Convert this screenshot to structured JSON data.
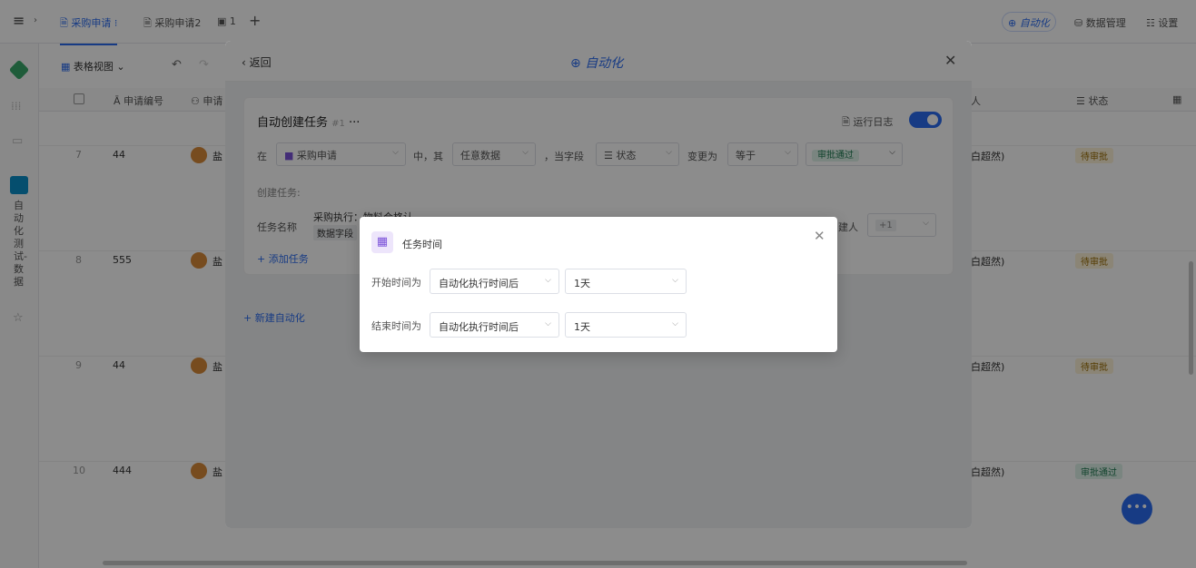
{
  "topbar": {
    "menu_icon": "≡",
    "tabs": [
      {
        "label": "采购申请 ⁝"
      },
      {
        "label": "采购申请2"
      },
      {
        "label": "1"
      }
    ],
    "add_tab": "+",
    "automation": "自动化",
    "data_manage": "数据管理",
    "settings": "设置"
  },
  "sidebar": {
    "vertical_title": "自动化测试-数据"
  },
  "toolbar": {
    "view": "表格视图"
  },
  "table": {
    "headers": [
      "申请编号",
      "申请",
      "人",
      "状态"
    ],
    "rows": [
      {
        "num": "7",
        "id": "44",
        "person": "盐",
        "owner": "（白超然)",
        "status": "待审批"
      },
      {
        "num": "8",
        "id": "555",
        "person": "盐",
        "owner": "（白超然)",
        "status": "待审批"
      },
      {
        "num": "9",
        "id": "44",
        "person": "盐",
        "owner": "（白超然)",
        "status": "待审批"
      },
      {
        "num": "10",
        "id": "444",
        "person": "盐",
        "owner": "（白超然)",
        "status": "审批通过"
      }
    ]
  },
  "modal": {
    "back": "返回",
    "title": "自动化",
    "task_title": "自动创建任务",
    "task_num": "#1",
    "run_log": "运行日志",
    "cond": {
      "in": "在",
      "table": "采购申请",
      "mid": "中，其",
      "data": "任意数据",
      "when_field": "，当字段",
      "field": "状态",
      "change": "变更为",
      "op": "等于",
      "value": "审批通过"
    },
    "create_task": "创建任务:",
    "task_name": "任务名称",
    "task_name_value": "采购执行：物料合格认",
    "data_field": "数据字段",
    "creator": "建人",
    "plus": "+1",
    "add_task": "+ 添加任务",
    "new_auto": "+ 新建自动化"
  },
  "dialog": {
    "title": "任务时间",
    "start_label": "开始时间为",
    "start_mode": "自动化执行时间后",
    "start_val": "1天",
    "end_label": "结束时间为",
    "end_mode": "自动化执行时间后",
    "end_val": "1天"
  },
  "colors": {
    "primary": "#2b6cf0",
    "dialog_icon_bg": "#ede5fb",
    "dialog_icon": "#7b52d9"
  }
}
